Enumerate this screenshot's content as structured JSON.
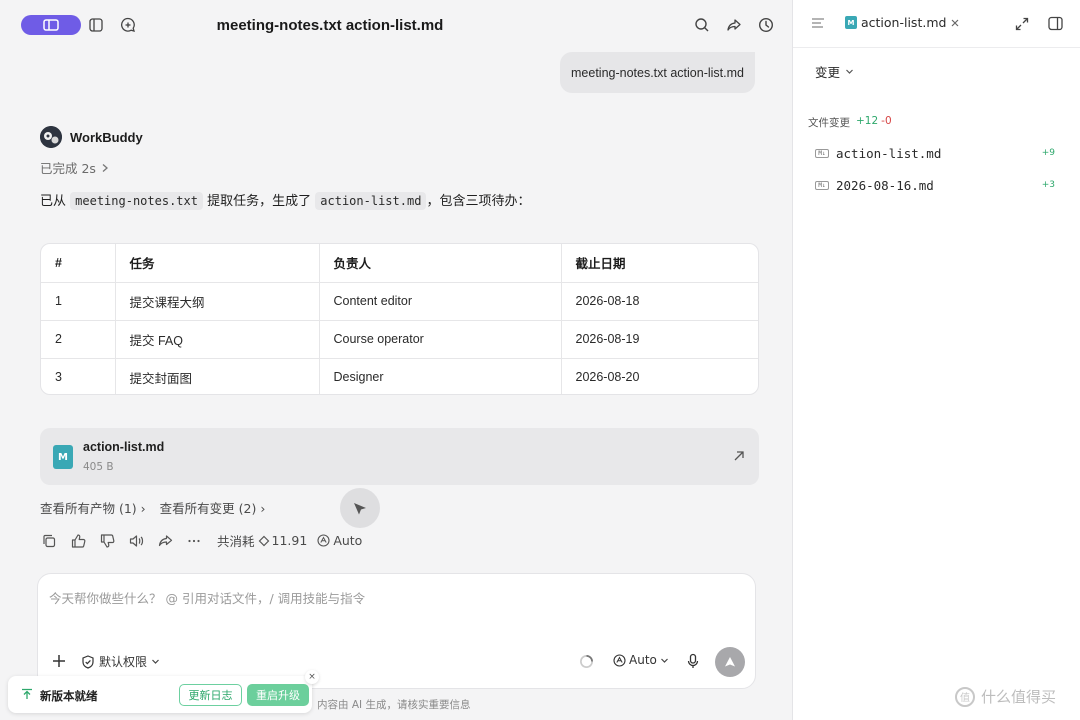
{
  "app": {
    "window_title": "meeting-notes.txt action-list.md"
  },
  "chat": {
    "user_message": "meeting-notes.txt action-list.md",
    "agent_name": "WorkBuddy",
    "done_label": "已完成 2s",
    "summary": {
      "prefix": "已从",
      "file1": "meeting-notes.txt",
      "middle": "提取任务，生成了",
      "file2": "action-list.md",
      "suffix": "，包含三项待办："
    },
    "table": {
      "headers": [
        "#",
        "任务",
        "负责人",
        "截止日期"
      ],
      "rows": [
        [
          "1",
          "提交课程大纲",
          "Content editor",
          "2026-08-18"
        ],
        [
          "2",
          "提交 FAQ",
          "Course operator",
          "2026-08-19"
        ],
        [
          "3",
          "提交封面图",
          "Designer",
          "2026-08-20"
        ]
      ]
    },
    "file_card": {
      "icon_letter": "M",
      "name": "action-list.md",
      "size": "405 B"
    },
    "links": {
      "artifacts": "查看所有产物 (1)",
      "changes": "查看所有变更 (2)"
    },
    "actions": {
      "cost_label": "共消耗",
      "cost_value": "11.91",
      "model": "Auto"
    }
  },
  "composer": {
    "placeholder": "今天帮你做些什么？ @ 引用对话文件，/ 调用技能与指令",
    "permission_label": "默认权限",
    "model_label": "Auto"
  },
  "disclaimer": "内容由 AI 生成，请核实重要信息",
  "toast": {
    "message": "新版本就绪",
    "changelog_button": "更新日志",
    "restart_button": "重启升级",
    "close": "×"
  },
  "side_panel": {
    "tab_label": "action-list.md",
    "tab_icon_letter": "M",
    "changes_dropdown": "变更",
    "file_changes_label": "文件变更",
    "additions": "+12",
    "deletions": "-0",
    "files": [
      {
        "name": "action-list.md",
        "count": "+9",
        "badge": "M↓"
      },
      {
        "name": "2026-08-16.md",
        "count": "+3",
        "badge": "M↓"
      }
    ]
  },
  "watermark": {
    "glyph": "值",
    "text": "什么值得买"
  },
  "colors": {
    "accent": "#6f5ce6",
    "md_icon": "#3aa8b5",
    "added": "#2ea86c",
    "removed": "#d64545",
    "toast_green": "#6ccf9c"
  }
}
